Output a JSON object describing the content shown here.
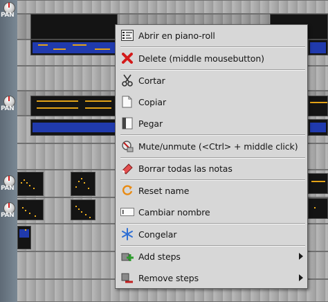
{
  "tracks": [
    {
      "pan_label": "PAN"
    },
    {
      "pan_label": "PAN"
    },
    {
      "pan_label": "PAN"
    },
    {
      "pan_label": "PAN"
    }
  ],
  "context_menu": {
    "items": [
      {
        "label": "Abrir en piano-roll",
        "icon": "piano-roll-icon"
      },
      {
        "label": "Delete (middle mousebutton)",
        "icon": "red-x-delete-icon"
      },
      {
        "label": "Cortar",
        "icon": "scissors-icon"
      },
      {
        "label": "Copiar",
        "icon": "copy-icon"
      },
      {
        "label": "Pegar",
        "icon": "paste-icon"
      },
      {
        "label": "Mute/unmute (<Ctrl> + middle click)",
        "icon": "mute-icon"
      },
      {
        "label": "Borrar todas las notas",
        "icon": "eraser-icon"
      },
      {
        "label": "Reset name",
        "icon": "reload-icon"
      },
      {
        "label": "Cambiar nombre",
        "icon": "rename-icon"
      },
      {
        "label": "Congelar",
        "icon": "snowflake-icon"
      },
      {
        "label": "Add steps",
        "icon": "add-steps-icon",
        "submenu": true
      },
      {
        "label": "Remove steps",
        "icon": "remove-steps-icon",
        "submenu": true
      }
    ]
  },
  "colors": {
    "menu_background": "#d7d7d7",
    "note_orange": "#e4a317",
    "note_blue": "#2241c8",
    "pattern_background": "#141414"
  }
}
